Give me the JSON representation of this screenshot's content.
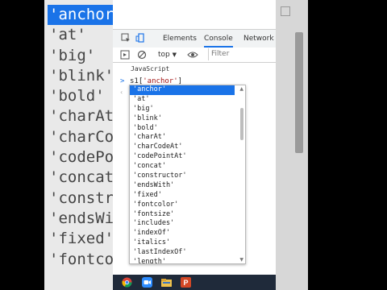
{
  "background_list": [
    "'anchor'",
    "'at'",
    "'big'",
    "'blink'",
    "'bold'",
    "'charAt'",
    "'charCo",
    "'codePo",
    "'concat",
    "'constr",
    "'endsWi",
    "'fixed'",
    "'fontco"
  ],
  "tabs": [
    {
      "label": "Elements"
    },
    {
      "label": "Console"
    },
    {
      "label": "Network"
    }
  ],
  "toolbar": {
    "context": "top",
    "filter_placeholder": "Filter"
  },
  "console": {
    "group_label": "JavaScript",
    "prompt": ">",
    "input_prefix": "s1[",
    "input_string": "'anchor'",
    "input_suffix": "]"
  },
  "autocomplete": {
    "items": [
      "'anchor'",
      "'at'",
      "'big'",
      "'blink'",
      "'bold'",
      "'charAt'",
      "'charCodeAt'",
      "'codePointAt'",
      "'concat'",
      "'constructor'",
      "'endsWith'",
      "'fixed'",
      "'fontcolor'",
      "'fontsize'",
      "'includes'",
      "'indexOf'",
      "'italics'",
      "'lastIndexOf'",
      "'length'"
    ],
    "selected_index": 0
  },
  "colors": {
    "accent": "#1a73e8",
    "taskbar": "#1f2a3a"
  },
  "icons": [
    "inspect-icon",
    "device-toggle-icon",
    "sidebar-toggle-icon",
    "clear-console-icon",
    "eye-icon",
    "chrome-icon",
    "zoom-icon",
    "file-explorer-icon",
    "powerpoint-icon"
  ]
}
